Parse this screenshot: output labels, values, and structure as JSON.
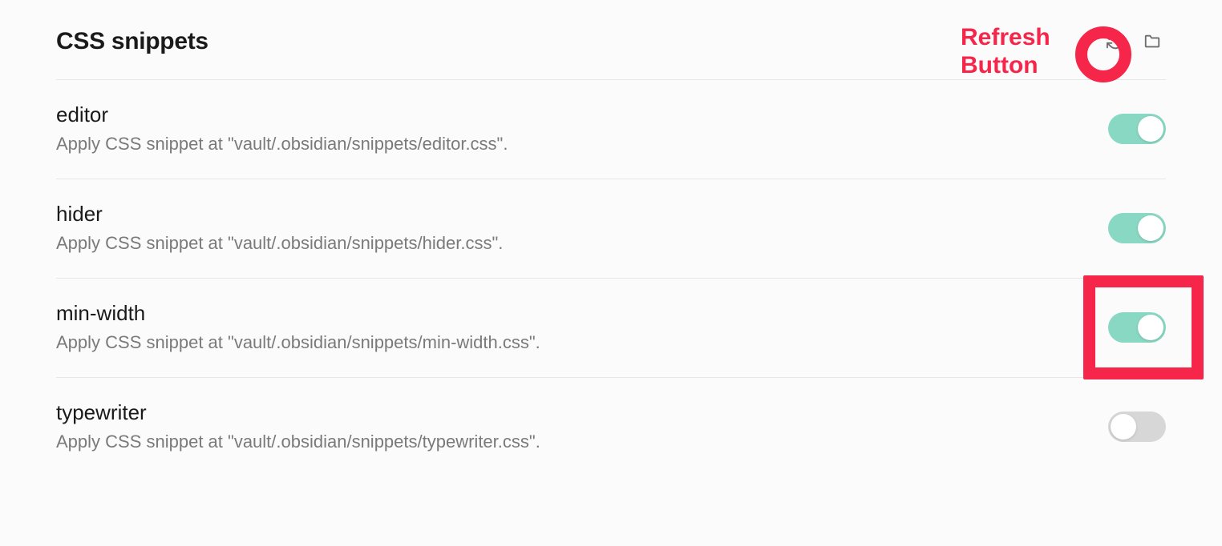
{
  "section": {
    "title": "CSS snippets"
  },
  "annotations": {
    "refresh_label_line1": "Refresh",
    "refresh_label_line2": "Button"
  },
  "snippets": [
    {
      "name": "editor",
      "desc": "Apply CSS snippet at \"vault/.obsidian/snippets/editor.css\".",
      "enabled": true,
      "highlight": false
    },
    {
      "name": "hider",
      "desc": "Apply CSS snippet at \"vault/.obsidian/snippets/hider.css\".",
      "enabled": true,
      "highlight": false
    },
    {
      "name": "min-width",
      "desc": "Apply CSS snippet at \"vault/.obsidian/snippets/min-width.css\".",
      "enabled": true,
      "highlight": true
    },
    {
      "name": "typewriter",
      "desc": "Apply CSS snippet at \"vault/.obsidian/snippets/typewriter.css\".",
      "enabled": false,
      "highlight": false
    }
  ]
}
